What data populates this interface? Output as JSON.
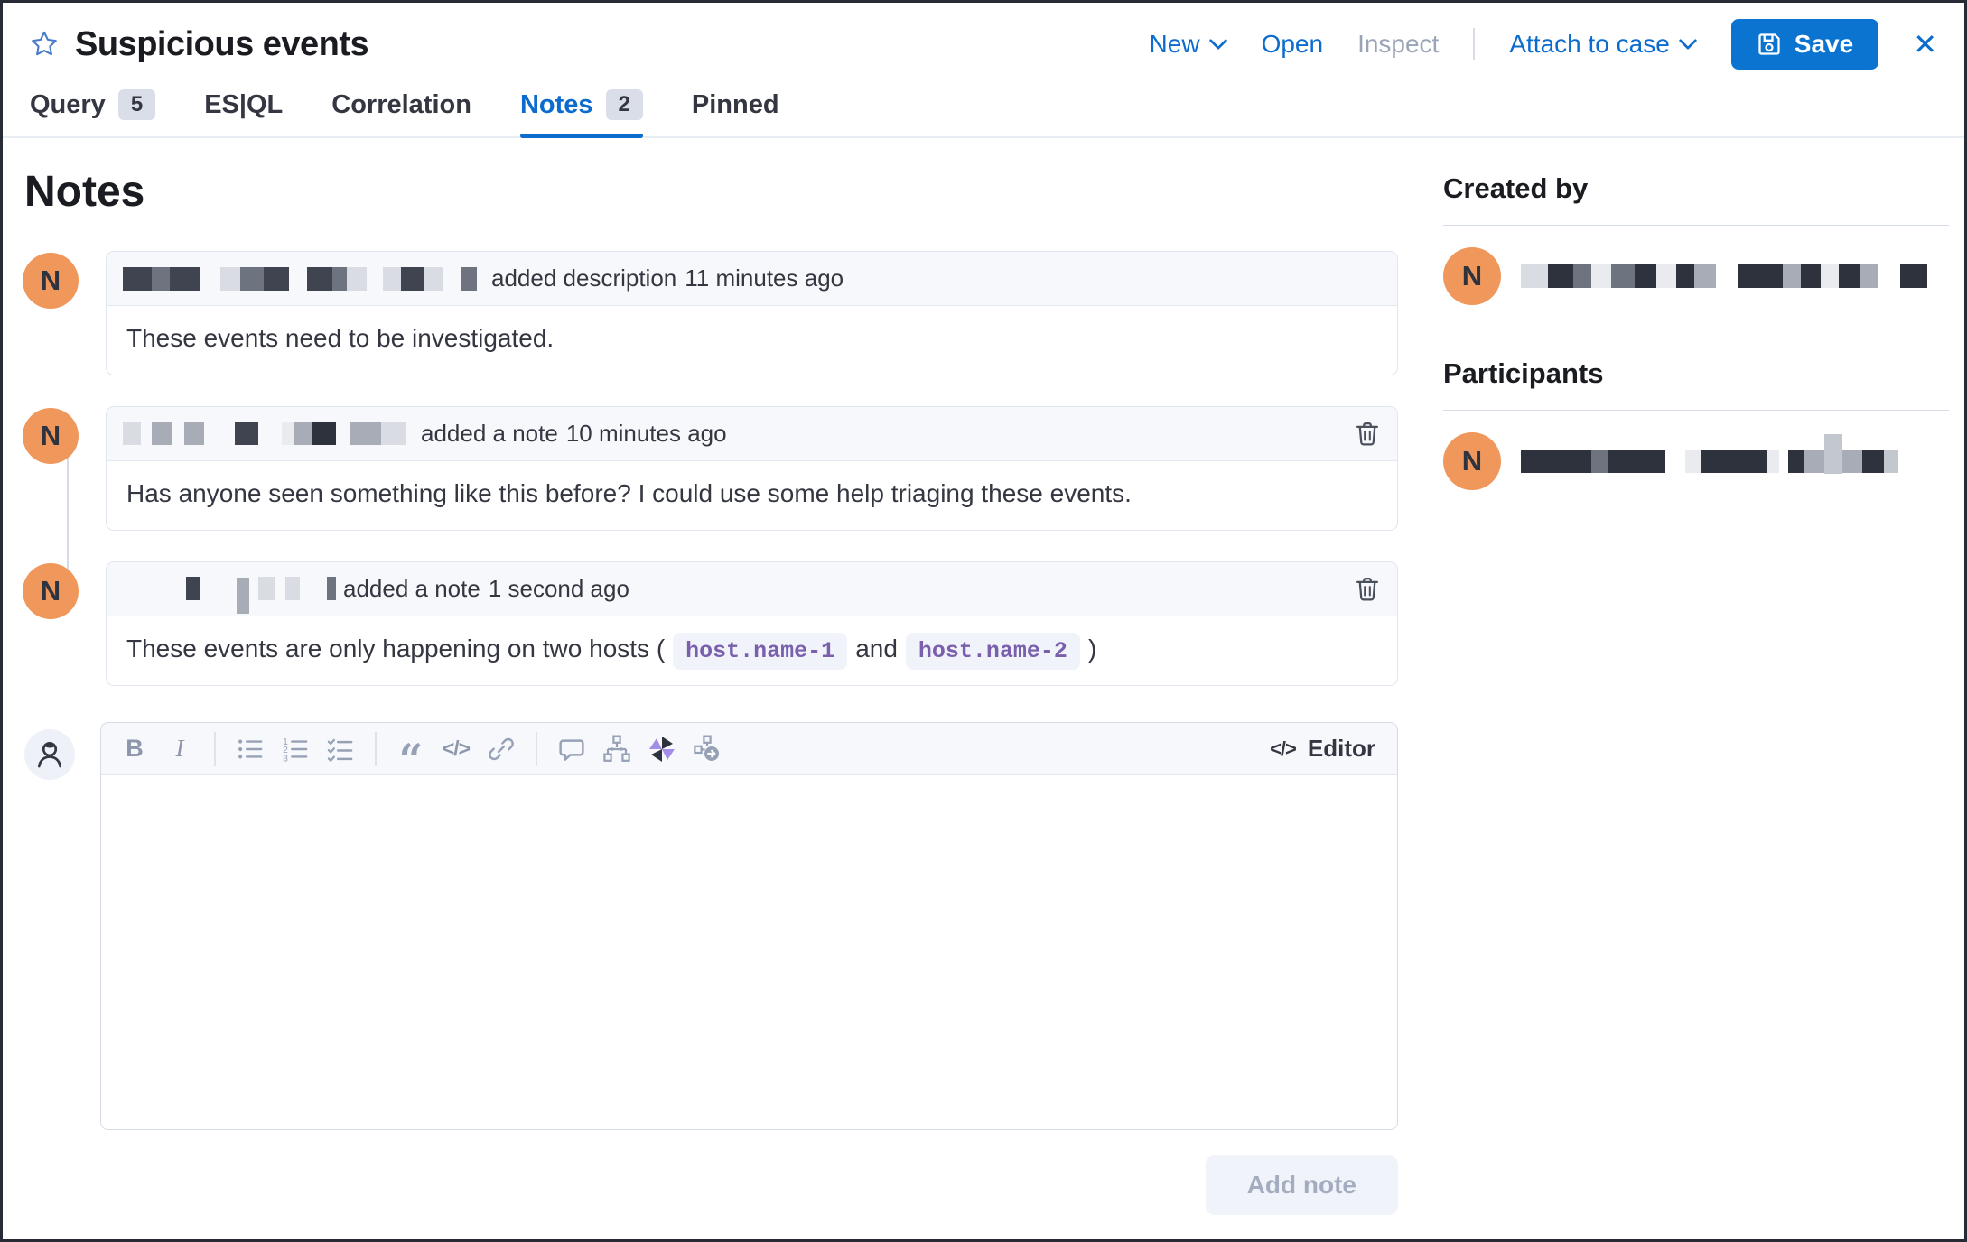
{
  "header": {
    "title": "Suspicious events",
    "actions": {
      "new": "New",
      "open": "Open",
      "inspect": "Inspect",
      "attach_to_case": "Attach to case",
      "save": "Save",
      "close_glyph": "✕"
    }
  },
  "tabs": {
    "query": {
      "label": "Query",
      "badge": "5"
    },
    "esql": {
      "label": "ES|QL"
    },
    "correlation": {
      "label": "Correlation"
    },
    "notes": {
      "label": "Notes",
      "badge": "2",
      "active": true
    },
    "pinned": {
      "label": "Pinned"
    }
  },
  "page_title": "Notes",
  "notes": [
    {
      "avatar": "N",
      "action": "added description",
      "time": "11 minutes ago",
      "body": "These events need to be investigated."
    },
    {
      "avatar": "N",
      "action": "added a note",
      "time": "10 minutes ago",
      "body": "Has anyone seen something like this before? I could use some help triaging these events."
    },
    {
      "avatar": "N",
      "action": "added a note",
      "time": "1 second ago",
      "body_prefix": "These events are only happening on two hosts (",
      "host_1": "host.name-1",
      "conjunction": "and",
      "host_2": "host.name-2",
      "body_suffix": ")"
    }
  ],
  "editor": {
    "toolbar": {
      "bold": "B",
      "italic": "I",
      "quote_glyph": "“",
      "code_glyph": "</>"
    },
    "label": "Editor",
    "label_icon_glyph": "</>",
    "add_note_label": "Add note"
  },
  "sidebar": {
    "created_by_title": "Created by",
    "created_by_avatar": "N",
    "participants_title": "Participants",
    "participants_avatar": "N"
  },
  "colors": {
    "accent_blue": "#0b6cce",
    "save_button_blue": "#0a74d0",
    "avatar_orange": "#f0985c",
    "chip_purple": "#7a5fad",
    "chip_bg": "#f1f3fb",
    "card_header_bg": "#f7f8fc",
    "card_border": "#e0e6f0",
    "disabled_text": "#9aa4b6"
  },
  "redactions": {
    "shades": {
      "l": "#d9dce2",
      "m": "#a7acb6",
      "g": "#6e747f",
      "d": "#3f4450",
      "dd": "#2e323c",
      "xl": "#e9ebef",
      "w": "#c3c7ce"
    },
    "note_authors": [
      [
        [
          32,
          "d",
          0
        ],
        [
          20,
          "g",
          0
        ],
        [
          34,
          "d",
          0
        ],
        [
          22,
          "l",
          22
        ],
        [
          26,
          "g",
          0
        ],
        [
          28,
          "d",
          0
        ],
        [
          28,
          "d",
          20
        ],
        [
          16,
          "g",
          0
        ],
        [
          22,
          "l",
          0
        ],
        [
          20,
          "l",
          18
        ],
        [
          26,
          "d",
          0
        ],
        [
          20,
          "l",
          0
        ],
        [
          18,
          "g",
          20
        ]
      ],
      [
        [
          20,
          "l",
          0
        ],
        [
          22,
          "m",
          12
        ],
        [
          22,
          "m",
          14
        ],
        [
          26,
          "d",
          34
        ],
        [
          14,
          "xl",
          26
        ],
        [
          20,
          "m",
          0
        ],
        [
          26,
          "dd",
          0
        ],
        [
          34,
          "m",
          16
        ],
        [
          28,
          "l",
          0
        ]
      ],
      [
        [
          16,
          "d",
          70
        ],
        [
          14,
          "m",
          40,
          40,
          8
        ],
        [
          18,
          "l",
          10
        ],
        [
          16,
          "l",
          12
        ],
        [
          10,
          "g",
          30
        ]
      ]
    ],
    "created_by_name": [
      [
        30,
        "l",
        0
      ],
      [
        28,
        "dd",
        0
      ],
      [
        20,
        "g",
        0
      ],
      [
        22,
        "xl",
        0
      ],
      [
        26,
        "g",
        0
      ],
      [
        24,
        "dd",
        0
      ],
      [
        22,
        "xl",
        0
      ],
      [
        20,
        "dd",
        0
      ],
      [
        24,
        "m",
        0
      ],
      [
        28,
        "dd",
        24
      ],
      [
        22,
        "dd",
        0
      ],
      [
        20,
        "m",
        0
      ],
      [
        22,
        "dd",
        0
      ],
      [
        20,
        "xl",
        0
      ],
      [
        24,
        "dd",
        0
      ],
      [
        20,
        "m",
        0
      ],
      [
        30,
        "dd",
        24
      ]
    ],
    "participants_name": [
      [
        28,
        "dd",
        0
      ],
      [
        24,
        "dd",
        0
      ],
      [
        26,
        "dd",
        0
      ],
      [
        18,
        "g",
        0
      ],
      [
        30,
        "dd",
        0
      ],
      [
        34,
        "dd",
        0
      ],
      [
        18,
        "xl",
        22
      ],
      [
        26,
        "dd",
        0
      ],
      [
        22,
        "dd",
        0
      ],
      [
        24,
        "dd",
        0
      ],
      [
        14,
        "xl",
        0
      ],
      [
        18,
        "dd",
        10
      ],
      [
        22,
        "m",
        0
      ],
      [
        20,
        "w",
        0,
        44,
        -8
      ],
      [
        22,
        "m",
        0
      ],
      [
        24,
        "dd",
        0
      ],
      [
        16,
        "w",
        0
      ]
    ]
  }
}
